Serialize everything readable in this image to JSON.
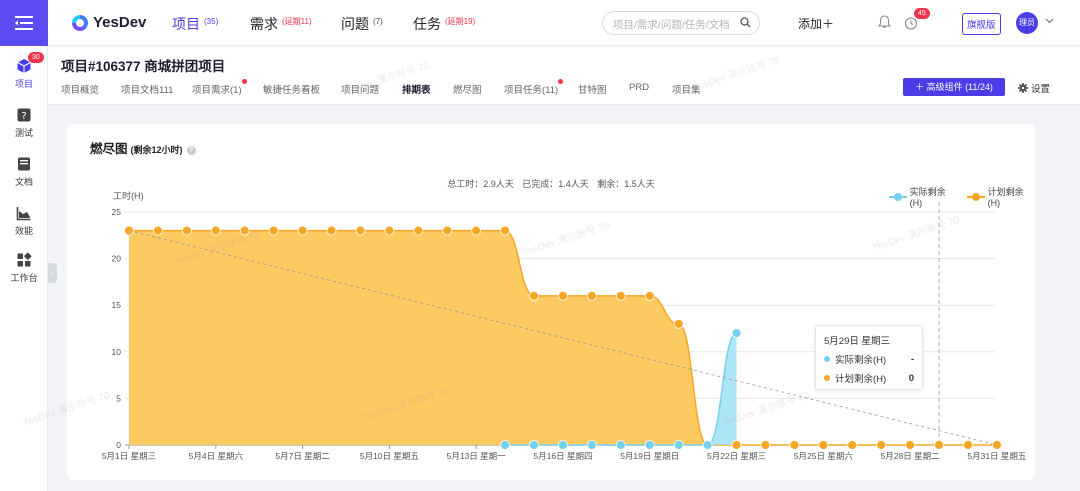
{
  "sidebar": {
    "items": [
      {
        "label": "项目",
        "icon": "project-icon",
        "badge": "30"
      },
      {
        "label": "测试",
        "icon": "test-icon"
      },
      {
        "label": "文档",
        "icon": "doc-icon"
      },
      {
        "label": "效能",
        "icon": "efficiency-icon"
      },
      {
        "label": "工作台",
        "icon": "workbench-icon"
      }
    ]
  },
  "topbar": {
    "brand": "YesDev",
    "nav": [
      {
        "label": "项目",
        "count": "(35)"
      },
      {
        "label": "需求",
        "count": "(延期11)"
      },
      {
        "label": "问题",
        "count": "(7)"
      },
      {
        "label": "任务",
        "count": "(延期19)"
      }
    ],
    "search_placeholder": "项目/需求/问题/任务/文档",
    "add_label": "添加＋",
    "notification_badge": "45",
    "edition": "旗舰版",
    "avatar_text": "理员"
  },
  "project": {
    "title": "项目#106377 商城拼团项目",
    "tabs": [
      "项目概览",
      "项目文档111",
      "项目需求(1)",
      "敏捷任务看板",
      "项目问题",
      "排期表",
      "燃尽图",
      "项目任务(11)",
      "甘特图",
      "PRD",
      "项目集"
    ],
    "advanced_button": "＋ 高级组件 (11/24)",
    "settings_label": "设置"
  },
  "watermark": "YesDev 演示账号 70",
  "chart_card": {
    "title": "燃尽图",
    "subtitle": "(剩余12小时)",
    "stats": [
      "总工时：2.9人天",
      "已完成：1.4人天",
      "剩余：1.5人天"
    ],
    "tooltip": {
      "date": "5月29日 星期三",
      "rows": [
        {
          "label": "实际剩余(H)",
          "value": "-"
        },
        {
          "label": "计划剩余(H)",
          "value": "0"
        }
      ]
    }
  },
  "chart_data": {
    "type": "area",
    "ylabel": "工时(H)",
    "ylim": [
      0,
      25
    ],
    "yticks": [
      0,
      5,
      10,
      15,
      20,
      25
    ],
    "grid": true,
    "legend_position": "top-right",
    "x": [
      "5月1日",
      "5月2日",
      "5月3日",
      "5月4日",
      "5月5日",
      "5月6日",
      "5月7日",
      "5月8日",
      "5月9日",
      "5月10日",
      "5月11日",
      "5月12日",
      "5月13日",
      "5月14日",
      "5月15日",
      "5月16日",
      "5月17日",
      "5月18日",
      "5月19日",
      "5月20日",
      "5月21日",
      "5月22日",
      "5月23日",
      "5月24日",
      "5月25日",
      "5月26日",
      "5月27日",
      "5月28日",
      "5月29日",
      "5月30日",
      "5月31日"
    ],
    "xtick_labels": [
      "5月1日 星期三",
      "5月4日 星期六",
      "5月7日 星期二",
      "5月10日 星期五",
      "5月13日 星期一",
      "5月16日 星期四",
      "5月19日 星期日",
      "5月22日 星期三",
      "5月25日 星期六",
      "5月28日 星期二",
      "5月31日 星期五"
    ],
    "series": [
      {
        "name": "实际剩余(H)",
        "color": "#76cfee",
        "values": [
          null,
          null,
          null,
          null,
          null,
          null,
          null,
          null,
          null,
          null,
          null,
          null,
          null,
          0,
          0,
          0,
          0,
          0,
          0,
          0,
          0,
          12,
          null,
          null,
          null,
          null,
          null,
          null,
          null,
          null,
          null
        ]
      },
      {
        "name": "计划剩余(H)",
        "color": "#f5a623",
        "values": [
          23,
          23,
          23,
          23,
          23,
          23,
          23,
          23,
          23,
          23,
          23,
          23,
          23,
          23,
          16,
          16,
          16,
          16,
          16,
          13,
          0,
          0,
          0,
          0,
          0,
          0,
          0,
          0,
          0,
          0,
          0
        ]
      }
    ],
    "ideal_line": [
      23,
      0
    ],
    "highlight_index": 28
  }
}
